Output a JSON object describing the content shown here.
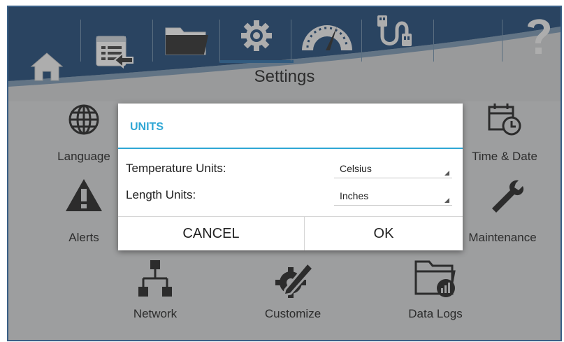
{
  "header": {
    "title": "Settings",
    "icons": [
      "home-icon",
      "screen-return-icon",
      "folder-icon",
      "gear-icon",
      "gauge-icon",
      "usb-icon",
      "help-icon"
    ]
  },
  "tiles": {
    "language": "Language",
    "time_date": "Time & Date",
    "alerts": "Alerts",
    "maintenance": "Maintenance",
    "network": "Network",
    "customize": "Customize",
    "data_logs": "Data Logs"
  },
  "dialog": {
    "title": "UNITS",
    "temperature_label": "Temperature Units:",
    "temperature_value": "Celsius",
    "length_label": "Length Units:",
    "length_value": "Inches",
    "cancel_label": "CANCEL",
    "ok_label": "OK"
  },
  "colors": {
    "accent": "#2fa7d5",
    "header_dark": "#1f4a78",
    "frame": "#3a5f86"
  }
}
